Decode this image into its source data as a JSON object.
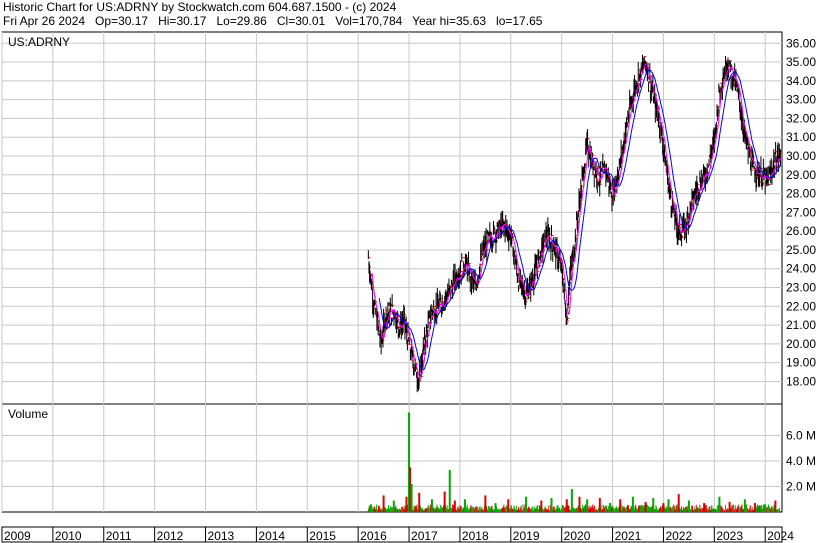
{
  "header": {
    "line1": "Historic Chart for US:ADRNY by Stockwatch.com 604.687.1500 - (c) 2024",
    "line2": "Fri Apr 26 2024   Op=30.17   Hi=30.17   Lo=29.86   Cl=30.01   Vol=170,784   Year hi=35.63   lo=17.65"
  },
  "colors": {
    "price_bar": "#000000",
    "close_tick": "#ff0000",
    "ma_short": "#ff00ff",
    "ma_long": "#0000ff",
    "vol_up": "#00aa00",
    "vol_down": "#dd0000",
    "grid": "#c8c8c8"
  },
  "chart_data": [
    {
      "type": "line",
      "label": "US:ADRNY",
      "y_axis_side": "right",
      "ylim": [
        17,
        36.5
      ],
      "yticks": [
        "36.00",
        "35.00",
        "34.00",
        "33.00",
        "32.00",
        "31.00",
        "30.00",
        "29.00",
        "28.00",
        "27.00",
        "26.00",
        "25.00",
        "24.00",
        "23.00",
        "22.00",
        "21.00",
        "20.00",
        "19.00",
        "18.00"
      ],
      "x_years": [
        "2009",
        "2010",
        "2011",
        "2012",
        "2013",
        "2014",
        "2015",
        "2016",
        "2017",
        "2018",
        "2019",
        "2020",
        "2021",
        "2022",
        "2023",
        "2024"
      ],
      "x_start_year": 2009,
      "x_end_year": 2024.33,
      "series": [
        {
          "x": [
            2016.2,
            2016.3,
            2016.45,
            2016.55,
            2016.7,
            2016.8,
            2016.9,
            2017.0,
            2017.1,
            2017.2,
            2017.3,
            2017.45,
            2017.6,
            2017.8,
            2017.95,
            2018.1,
            2018.3,
            2018.45,
            2018.55,
            2018.7,
            2018.85,
            2019.0,
            2019.15,
            2019.3,
            2019.45,
            2019.6,
            2019.7,
            2019.85,
            2020.0,
            2020.1,
            2020.15,
            2020.25,
            2020.35,
            2020.5,
            2020.6,
            2020.75,
            2020.85,
            2021.0,
            2021.15,
            2021.3,
            2021.45,
            2021.55,
            2021.65,
            2021.8,
            2021.95,
            2022.1,
            2022.2,
            2022.3,
            2022.45,
            2022.55,
            2022.7,
            2022.85,
            2023.0,
            2023.1,
            2023.25,
            2023.4,
            2023.5,
            2023.6,
            2023.75,
            2023.9,
            2024.05,
            2024.2,
            2024.3
          ],
          "values": [
            24.6,
            22.3,
            20.0,
            21.6,
            21.8,
            20.9,
            21.2,
            20.0,
            18.9,
            18.0,
            20.0,
            21.8,
            22.0,
            22.8,
            23.7,
            24.3,
            23.0,
            24.9,
            25.5,
            25.9,
            26.3,
            25.8,
            23.4,
            22.6,
            23.6,
            24.9,
            25.8,
            25.2,
            24.0,
            21.2,
            23.3,
            25.2,
            27.6,
            30.6,
            29.7,
            28.7,
            29.4,
            27.9,
            29.6,
            32.0,
            33.8,
            34.4,
            35.0,
            33.2,
            31.5,
            28.4,
            27.0,
            25.9,
            26.3,
            27.5,
            28.5,
            29.2,
            30.8,
            33.5,
            35.0,
            34.0,
            32.8,
            31.0,
            29.4,
            29.0,
            28.6,
            29.8,
            30.0
          ]
        }
      ]
    },
    {
      "type": "bar",
      "label": "Volume",
      "y_axis_side": "right",
      "ylim": [
        0,
        8000000
      ],
      "yticks": [
        "6.0 M",
        "4.0 M",
        "2.0 M"
      ],
      "series": [
        {
          "x": [
            2016.25,
            2016.5,
            2016.7,
            2016.95,
            2017.0,
            2017.02,
            2017.05,
            2017.2,
            2017.45,
            2017.7,
            2017.8,
            2017.9,
            2018.1,
            2018.5,
            2018.7,
            2018.95,
            2019.3,
            2019.6,
            2019.8,
            2020.1,
            2020.2,
            2020.35,
            2020.5,
            2020.75,
            2020.95,
            2021.15,
            2021.4,
            2021.65,
            2021.8,
            2022.0,
            2022.1,
            2022.3,
            2022.5,
            2022.8,
            2023.1,
            2023.3,
            2023.6,
            2023.8,
            2024.0,
            2024.2
          ],
          "values": [
            600000,
            1300000,
            900000,
            1200000,
            7800000,
            3500000,
            2200000,
            1500000,
            1000000,
            1600000,
            3300000,
            900000,
            1000000,
            1300000,
            700000,
            1000000,
            1200000,
            900000,
            1100000,
            1000000,
            1800000,
            1200000,
            1000000,
            1100000,
            700000,
            1000000,
            1200000,
            800000,
            1100000,
            700000,
            1000000,
            1400000,
            900000,
            700000,
            1200000,
            800000,
            1000000,
            700000,
            600000,
            900000
          ]
        }
      ]
    }
  ]
}
